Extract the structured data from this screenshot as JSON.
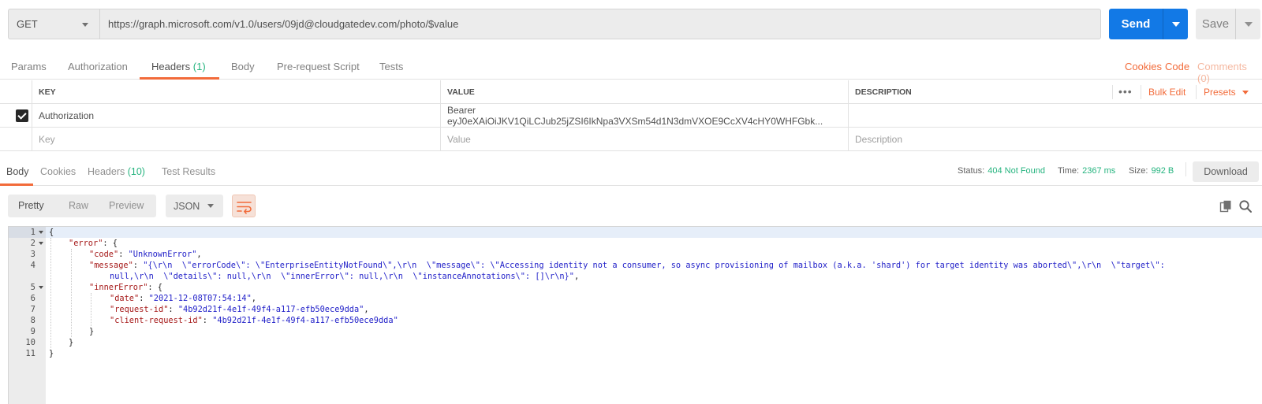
{
  "request": {
    "method": "GET",
    "url": "https://graph.microsoft.com/v1.0/users/09jd@cloudgatedev.com/photo/$value",
    "send_label": "Send",
    "save_label": "Save"
  },
  "request_tabs": {
    "params": "Params",
    "authorization": "Authorization",
    "headers": "Headers",
    "headers_count": "(1)",
    "body": "Body",
    "prerequest": "Pre-request Script",
    "tests": "Tests",
    "cookies": "Cookies",
    "code": "Code",
    "comments": "Comments (0)"
  },
  "headers_table": {
    "col_key": "KEY",
    "col_value": "VALUE",
    "col_description": "DESCRIPTION",
    "more": "•••",
    "bulk_edit": "Bulk Edit",
    "presets": "Presets",
    "rows": [
      {
        "key": "Authorization",
        "value": "Bearer eyJ0eXAiOiJKV1QiLCJub25jZSI6IkNpa3VXSm54d1N3dmVXOE9CcXV4cHY0WHFGbk...",
        "description": ""
      }
    ],
    "placeholder": {
      "key": "Key",
      "value": "Value",
      "description": "Description"
    }
  },
  "response_tabs": {
    "body": "Body",
    "cookies": "Cookies",
    "headers": "Headers",
    "headers_count": "(10)",
    "test_results": "Test Results"
  },
  "response_status": {
    "status_label": "Status:",
    "status_value": "404 Not Found",
    "time_label": "Time:",
    "time_value": "2367 ms",
    "size_label": "Size:",
    "size_value": "992 B",
    "download_label": "Download"
  },
  "body_toolbar": {
    "pretty": "Pretty",
    "raw": "Raw",
    "preview": "Preview",
    "format": "JSON"
  },
  "editor": {
    "line_numbers": [
      "1",
      "2",
      "3",
      "4",
      "",
      "5",
      "6",
      "7",
      "8",
      "9",
      "10",
      "11"
    ],
    "lines": {
      "l1": "{",
      "l2_key": "\"error\"",
      "l2_rest": ": {",
      "l3_key": "\"code\"",
      "l3_colon": ": ",
      "l3_val": "\"UnknownError\"",
      "l3_end": ",",
      "l4_key": "\"message\"",
      "l4_colon": ": ",
      "l4_val_a": "\"{\\r\\n  \\\"errorCode\\\": \\\"EnterpriseEntityNotFound\\\",\\r\\n  \\\"message\\\": \\\"Accessing identity not a consumer, so async provisioning of mailbox (a.k.a. 'shard') for target identity was aborted\\\",\\r\\n  \\\"target\\\":",
      "l4_val_b": "null,\\r\\n  \\\"details\\\": null,\\r\\n  \\\"innerError\\\": null,\\r\\n  \\\"instanceAnnotations\\\": []\\r\\n}\"",
      "l4_end": ",",
      "l5_key": "\"innerError\"",
      "l5_rest": ": {",
      "l6_key": "\"date\"",
      "l6_colon": ": ",
      "l6_val": "\"2021-12-08T07:54:14\"",
      "l6_end": ",",
      "l7_key": "\"request-id\"",
      "l7_colon": ": ",
      "l7_val": "\"4b92d21f-4e1f-49f4-a117-efb50ece9dda\"",
      "l7_end": ",",
      "l8_key": "\"client-request-id\"",
      "l8_colon": ": ",
      "l8_val": "\"4b92d21f-4e1f-49f4-a117-efb50ece9dda\"",
      "l9": "}",
      "l10": "}",
      "l11": "}"
    }
  },
  "colors": {
    "accent": "#f26b3a",
    "send": "#1279e6",
    "status_ok": "#26b47f",
    "json_key": "#a61a1a",
    "json_string": "#1f1ec8"
  },
  "icons": {
    "wrap": "wrap-lines-icon",
    "copy": "copy-icon",
    "search": "search-icon",
    "checkbox": "checkbox-checked-icon"
  }
}
